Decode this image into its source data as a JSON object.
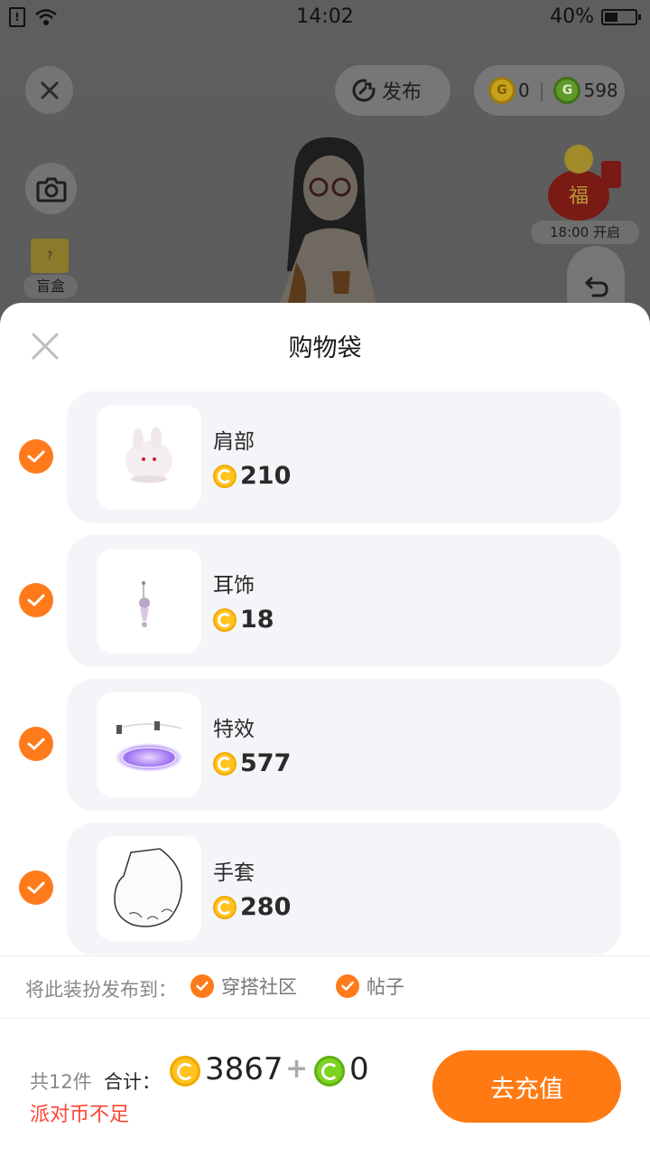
{
  "status_bar": {
    "time": "14:02",
    "battery": "40%"
  },
  "top_bar": {
    "publish_label": "发布",
    "gold_balance": "0",
    "green_balance": "598"
  },
  "event": {
    "timer": "18:00 开启"
  },
  "blind_box": {
    "label": "盲盒"
  },
  "sheet": {
    "title": "购物袋",
    "items": [
      {
        "name": "肩部",
        "price": "210",
        "checked": true
      },
      {
        "name": "耳饰",
        "price": "18",
        "checked": true
      },
      {
        "name": "特效",
        "price": "577",
        "checked": true
      },
      {
        "name": "手套",
        "price": "280",
        "checked": true
      }
    ],
    "publish": {
      "label": "将此装扮发布到：",
      "options": [
        {
          "label": "穿搭社区",
          "checked": true
        },
        {
          "label": "帖子",
          "checked": true
        }
      ]
    },
    "footer": {
      "count": "共12件",
      "total_label": "合计：",
      "gold_total": "3867",
      "plus": "+",
      "green_total": "0",
      "warning": "派对币不足",
      "recharge_button": "去充值"
    }
  },
  "colors": {
    "accent": "#ff7a12",
    "gold_coin": "#ffc21f",
    "green_coin": "#7ed321",
    "warning": "#ff4433",
    "card_bg": "#f3f5f8"
  }
}
